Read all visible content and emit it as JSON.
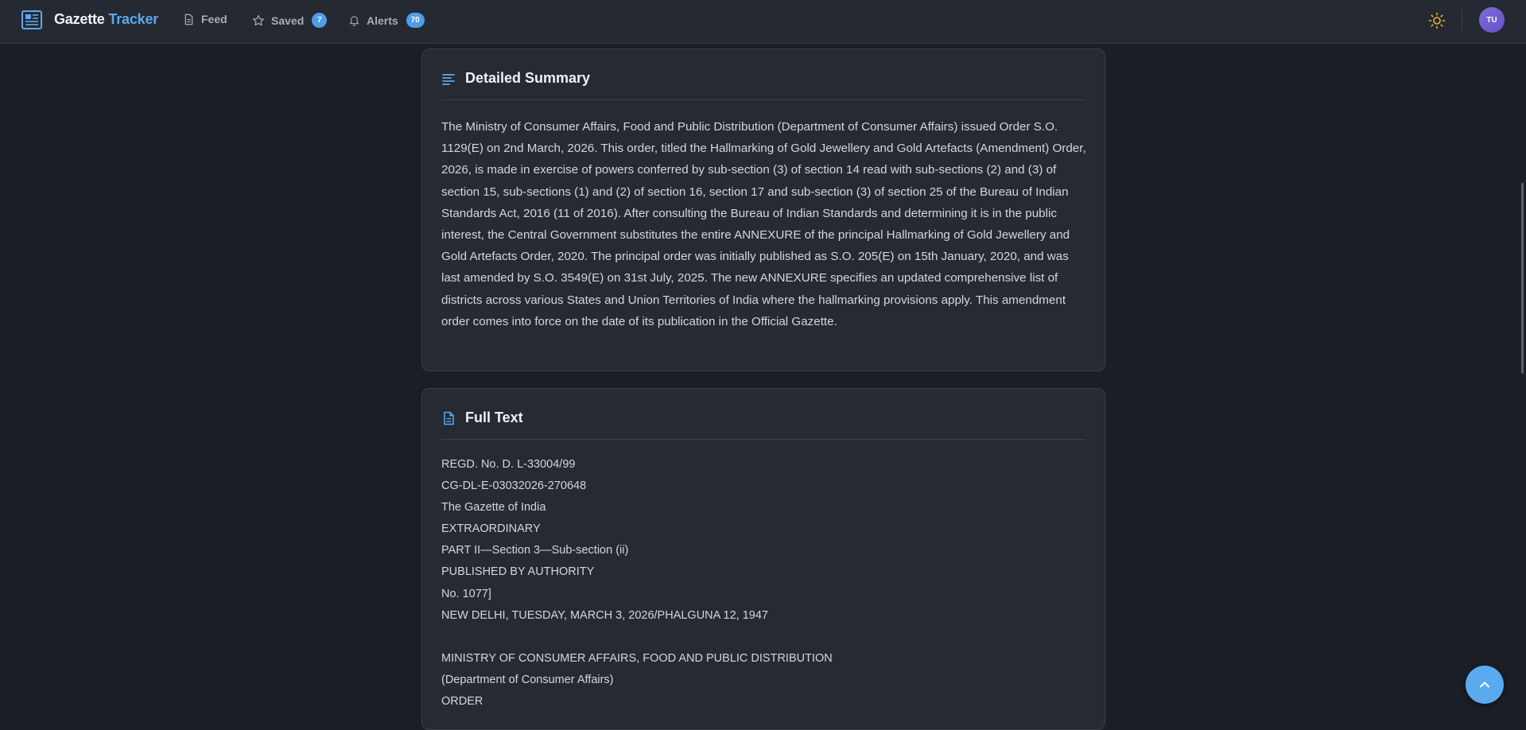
{
  "header": {
    "brand_part1": "Gazette",
    "brand_part2": "Tracker",
    "nav": {
      "feed_label": "Feed",
      "saved_label": "Saved",
      "saved_count": "7",
      "alerts_label": "Alerts",
      "alerts_count": "70"
    },
    "avatar_initials": "TU",
    "theme_icon": "sun-icon"
  },
  "summary": {
    "title": "Detailed Summary",
    "icon": "align-left-icon",
    "text": "The Ministry of Consumer Affairs, Food and Public Distribution (Department of Consumer Affairs) issued Order S.O. 1129(E) on 2nd March, 2026. This order, titled the Hallmarking of Gold Jewellery and Gold Artefacts (Amendment) Order, 2026, is made in exercise of powers conferred by sub-section (3) of section 14 read with sub-sections (2) and (3) of section 15, sub-sections (1) and (2) of section 16, section 17 and sub-section (3) of section 25 of the Bureau of Indian Standards Act, 2016 (11 of 2016). After consulting the Bureau of Indian Standards and determining it is in the public interest, the Central Government substitutes the entire ANNEXURE of the principal Hallmarking of Gold Jewellery and Gold Artefacts Order, 2020. The principal order was initially published as S.O. 205(E) on 15th January, 2020, and was last amended by S.O. 3549(E) on 31st July, 2025. The new ANNEXURE specifies an updated comprehensive list of districts across various States and Union Territories of India where the hallmarking provisions apply. This amendment order comes into force on the date of its publication in the Official Gazette."
  },
  "full_text": {
    "title": "Full Text",
    "icon": "document-icon",
    "lines": [
      "REGD. No. D. L-33004/99",
      "CG-DL-E-03032026-270648",
      "The Gazette of India",
      "EXTRAORDINARY",
      "PART II—Section 3—Sub-section (ii)",
      "PUBLISHED BY AUTHORITY",
      "No. 1077]",
      "NEW DELHI, TUESDAY, MARCH 3, 2026/PHALGUNA 12, 1947",
      "",
      "MINISTRY OF CONSUMER AFFAIRS, FOOD AND PUBLIC DISTRIBUTION",
      "(Department of Consumer Affairs)",
      "ORDER"
    ]
  }
}
